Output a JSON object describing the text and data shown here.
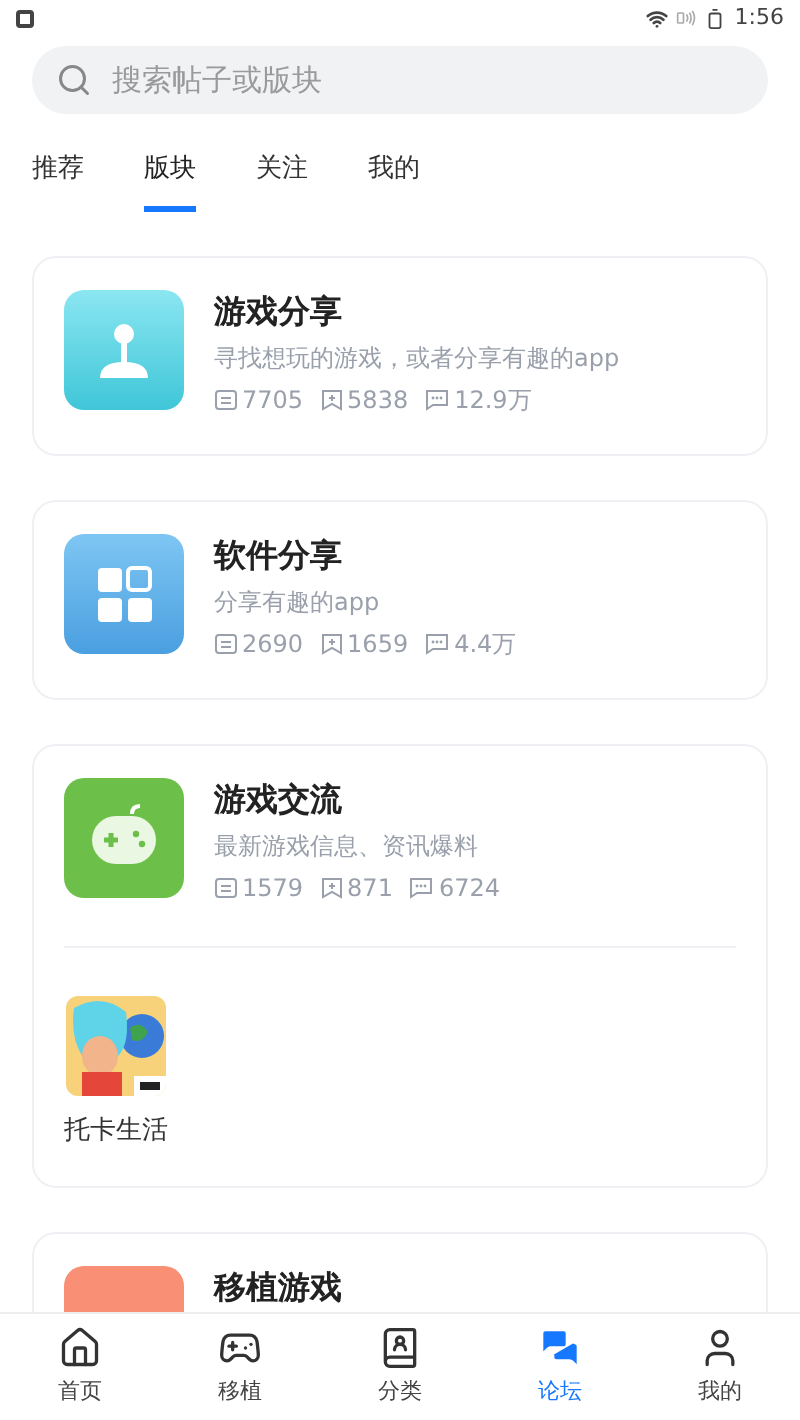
{
  "status_bar": {
    "time": "1:56"
  },
  "search": {
    "placeholder": "搜索帖子或版块"
  },
  "tabs": [
    {
      "label": "推荐",
      "selected": false
    },
    {
      "label": "版块",
      "selected": true
    },
    {
      "label": "关注",
      "selected": false
    },
    {
      "label": "我的",
      "selected": false
    }
  ],
  "forums": [
    {
      "title": "游戏分享",
      "description": "寻找想玩的游戏，或者分享有趣的app",
      "stats": [
        {
          "kind": "posts",
          "value": "7705"
        },
        {
          "kind": "bookmarks",
          "value": "5838"
        },
        {
          "kind": "comments",
          "value": "12.9万"
        }
      ]
    },
    {
      "title": "软件分享",
      "description": "分享有趣的app",
      "stats": [
        {
          "kind": "posts",
          "value": "2690"
        },
        {
          "kind": "bookmarks",
          "value": "1659"
        },
        {
          "kind": "comments",
          "value": "4.4万"
        }
      ]
    },
    {
      "title": "游戏交流",
      "description": "最新游戏信息、资讯爆料",
      "stats": [
        {
          "kind": "posts",
          "value": "1579"
        },
        {
          "kind": "bookmarks",
          "value": "871"
        },
        {
          "kind": "comments",
          "value": "6724"
        }
      ],
      "games": [
        {
          "name": "托卡生活",
          "kind": "picture"
        }
      ]
    },
    {
      "title": "移植游戏"
    }
  ],
  "bottom_nav": [
    {
      "label": "首页",
      "selected": false
    },
    {
      "label": "移植",
      "selected": false
    },
    {
      "label": "分类",
      "selected": false
    },
    {
      "label": "论坛",
      "selected": true
    },
    {
      "label": "我的",
      "selected": false
    }
  ]
}
